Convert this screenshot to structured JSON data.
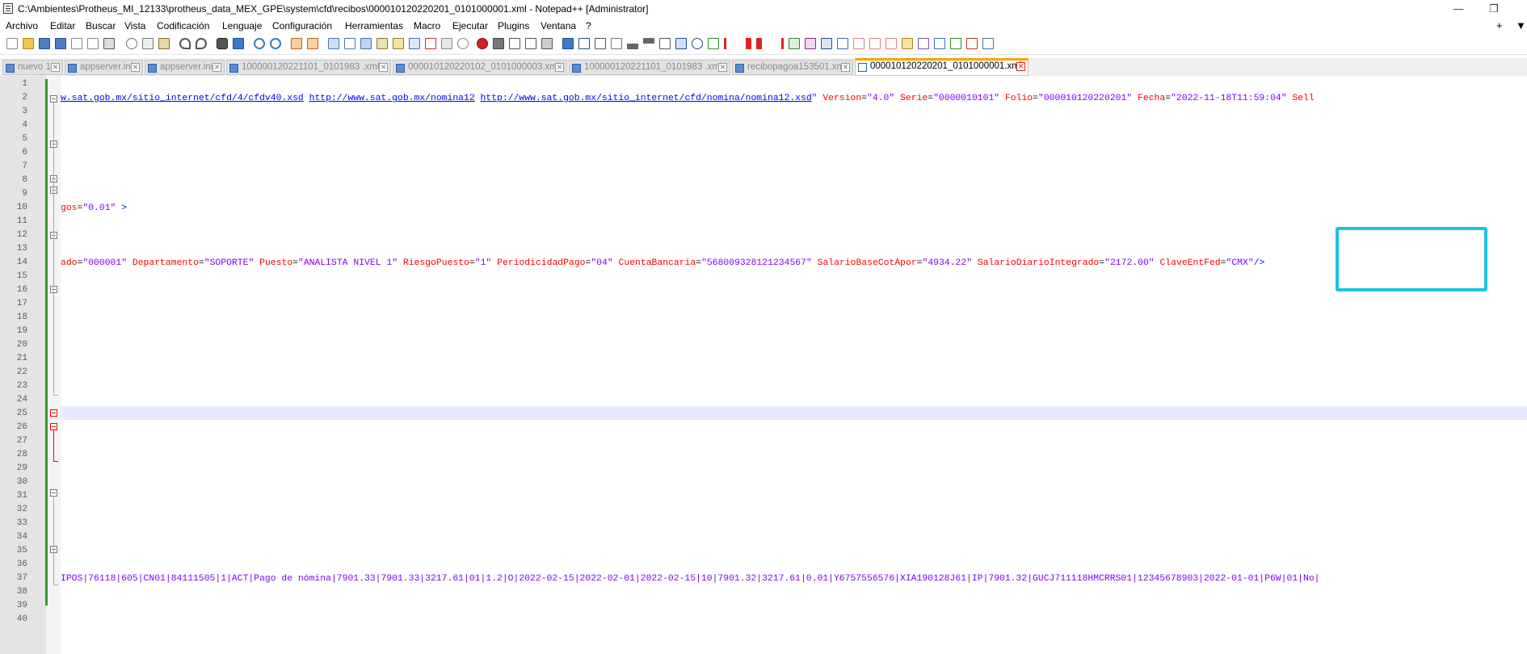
{
  "window": {
    "title": "C:\\Ambientes\\Protheus_MI_12133\\protheus_data_MEX_GPE\\system\\cfd\\recibos\\000010120220201_0101000001.xml - Notepad++ [Administrator]",
    "minimize": "—",
    "restore": "❐",
    "close": "✕"
  },
  "menu": {
    "items": [
      "Archivo",
      "Editar",
      "Buscar",
      "Vista",
      "Codificación",
      "Lenguaje",
      "Configuración",
      "Herramientas",
      "Macro",
      "Ejecutar",
      "Plugins",
      "Ventana",
      "?"
    ],
    "right_plus": "+",
    "right_arrow": "▼"
  },
  "tabs": [
    {
      "label": "nuevo 1",
      "active": false
    },
    {
      "label": "appserver.ini",
      "active": false
    },
    {
      "label": "appserver.ini",
      "active": false
    },
    {
      "label": "100000120221101_0101983   .xml",
      "active": false
    },
    {
      "label": "000010120220102_0101000003.xml",
      "active": false
    },
    {
      "label": "100000120221101_0101983   .xml",
      "active": false
    },
    {
      "label": "recibopagoa153501.xml",
      "active": false
    },
    {
      "label": "000010120220201_0101000001.xml",
      "active": true
    }
  ],
  "editor": {
    "line_numbers": [
      "1",
      "2",
      "3",
      "4",
      "5",
      "6",
      "7",
      "8",
      "9",
      "10",
      "11",
      "12",
      "13",
      "14",
      "15",
      "16",
      "17",
      "18",
      "19",
      "20",
      "21",
      "22",
      "23",
      "24",
      "25",
      "26",
      "27",
      "28",
      "29",
      "30",
      "31",
      "32",
      "33",
      "34",
      "35",
      "36",
      "37",
      "38",
      "39",
      "40"
    ],
    "line2": [
      {
        "t": "w.sat.gob.mx/sitio_internet/cfd/4/cfdv40.xsd",
        "c": "url"
      },
      {
        "t": " ",
        "c": "plain"
      },
      {
        "t": "http://www.sat.gob.mx/nomina12",
        "c": "url"
      },
      {
        "t": " ",
        "c": "plain"
      },
      {
        "t": "http://www.sat.gob.mx/sitio_internet/cfd/nomina/nomina12.xsd",
        "c": "url"
      },
      {
        "t": "\"",
        "c": "val"
      },
      {
        "t": " Version",
        "c": "attr"
      },
      {
        "t": "=",
        "c": "plain"
      },
      {
        "t": "\"4.0\"",
        "c": "val"
      },
      {
        "t": " Serie",
        "c": "attr"
      },
      {
        "t": "=",
        "c": "plain"
      },
      {
        "t": "\"0000010101\"",
        "c": "val"
      },
      {
        "t": " Folio",
        "c": "attr"
      },
      {
        "t": "=",
        "c": "plain"
      },
      {
        "t": "\"000010120220201\"",
        "c": "val"
      },
      {
        "t": " Fecha",
        "c": "attr"
      },
      {
        "t": "=",
        "c": "plain"
      },
      {
        "t": "\"2022-11-18T11:59:04\"",
        "c": "val"
      },
      {
        "t": " Sell",
        "c": "attr"
      }
    ],
    "line10": [
      {
        "t": "gos",
        "c": "attr"
      },
      {
        "t": "=",
        "c": "plain"
      },
      {
        "t": "\"0.01\"",
        "c": "val"
      },
      {
        "t": " >",
        "c": "tag"
      }
    ],
    "line14": [
      {
        "t": "ado",
        "c": "attr"
      },
      {
        "t": "=",
        "c": "plain"
      },
      {
        "t": "\"000001\"",
        "c": "val"
      },
      {
        "t": " Departamento",
        "c": "attr"
      },
      {
        "t": "=",
        "c": "plain"
      },
      {
        "t": "\"SOPORTE\"",
        "c": "val"
      },
      {
        "t": " Puesto",
        "c": "attr"
      },
      {
        "t": "=",
        "c": "plain"
      },
      {
        "t": "\"ANALISTA NIVEL 1\"",
        "c": "val"
      },
      {
        "t": " RiesgoPuesto",
        "c": "attr"
      },
      {
        "t": "=",
        "c": "plain"
      },
      {
        "t": "\"1\"",
        "c": "val"
      },
      {
        "t": " PeriodicidadPago",
        "c": "attr"
      },
      {
        "t": "=",
        "c": "plain"
      },
      {
        "t": "\"04\"",
        "c": "val"
      },
      {
        "t": " CuentaBancaria",
        "c": "attr"
      },
      {
        "t": "=",
        "c": "plain"
      },
      {
        "t": "\"568009328121234567\"",
        "c": "val"
      },
      {
        "t": " SalarioBaseCotApor",
        "c": "attr"
      },
      {
        "t": "=",
        "c": "plain"
      },
      {
        "t": "\"4934.22\"",
        "c": "val"
      },
      {
        "t": " SalarioDiarioIntegrado",
        "c": "attr"
      },
      {
        "t": "=",
        "c": "plain"
      },
      {
        "t": "\"2172.00\"",
        "c": "val"
      },
      {
        "t": " ClaveEntFed",
        "c": "attr"
      },
      {
        "t": "=",
        "c": "plain"
      },
      {
        "t": "\"CMX\"",
        "c": "val"
      },
      {
        "t": "/>",
        "c": "tag"
      }
    ],
    "line37": "IPOS|76118|605|CN01|84111505|1|ACT|Pago de nómina|7901.33|7901.33|3217.61|01|1.2|O|2022-02-15|2022-02-01|2022-02-15|10|7901.32|3217.61|0.01|Y6757556576|XIA190128J61|IP|7901.32|GUCJ711118HMCRRS01|12345678903|2022-01-01|P6W|01|No|"
  },
  "colors": {
    "highlight_box": "#1bc3e0",
    "attribute": "#ff0000",
    "value": "#8000ff",
    "tag": "#0000ff",
    "change_bar": "#2d9e2d",
    "active_tab_accent": "#f7a400"
  }
}
